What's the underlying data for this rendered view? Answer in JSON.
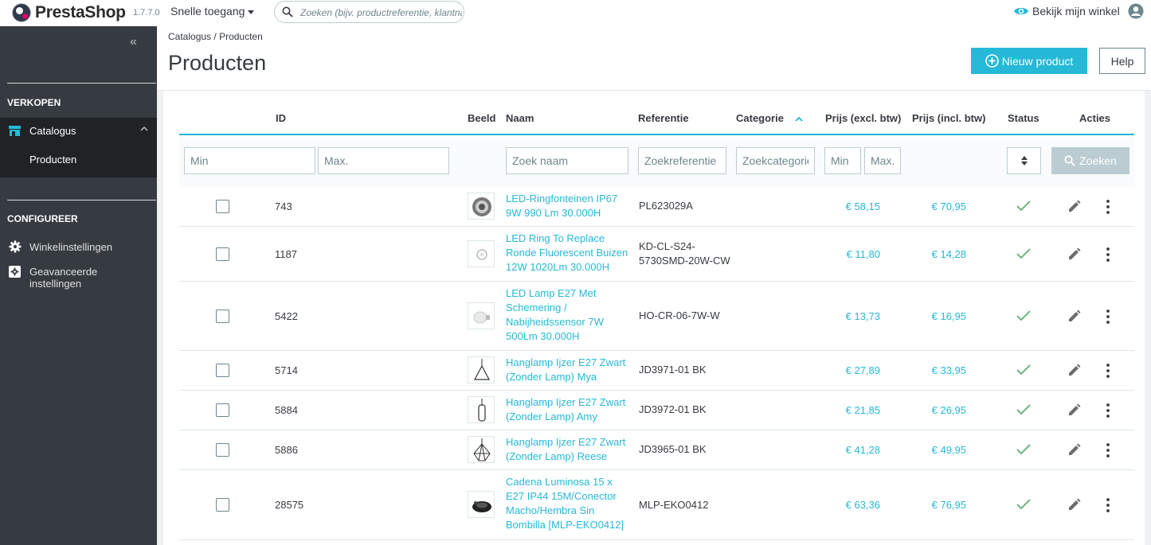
{
  "app": {
    "logo_text": "PrestaShop",
    "version": "1.7.7.0",
    "quick_access": "Snelle toegang",
    "search_placeholder": "Zoeken (bijv. productreferentie, klantnaam...)",
    "view_shop": "Bekijk mijn winkel"
  },
  "sidebar": {
    "section_sell": "VERKOPEN",
    "catalog": "Catalogus",
    "products": "Producten",
    "section_configure": "CONFIGUREER",
    "shop_settings": "Winkelinstellingen",
    "advanced_settings": "Geavanceerde instellingen"
  },
  "header": {
    "breadcrumb_parent": "Catalogus",
    "breadcrumb_sep": "/",
    "breadcrumb_current": "Producten",
    "title": "Producten",
    "new_product": "Nieuw product",
    "help": "Help"
  },
  "table": {
    "columns": {
      "id": "ID",
      "image": "Beeld",
      "name": "Naam",
      "reference": "Referentie",
      "category": "Categorie",
      "price_excl": "Prijs (excl. btw)",
      "price_incl": "Prijs (incl. btw)",
      "status": "Status",
      "actions": "Acties"
    },
    "filters": {
      "id_min": "Min",
      "id_max": "Max.",
      "name": "Zoek naam",
      "reference": "Zoekreferentie",
      "category": "Zoekcategorie",
      "price_min": "Min",
      "price_max": "Max.",
      "search_button": "Zoeken"
    },
    "rows": [
      {
        "id": "743",
        "name": "LED-Ringfonteinen IP67 9W 990 Lm 30.000H",
        "reference": "PL623029A",
        "price_excl": "€ 58,15",
        "price_incl": "€ 70,95",
        "thumb": "ring-fountain"
      },
      {
        "id": "1187",
        "name": "LED Ring To Replace Ronde Fluorescent Buizen 12W 1020Lm 30.000H",
        "reference": "KD-CL-S24-5730SMD-20W-CW",
        "price_excl": "€ 11,80",
        "price_incl": "€ 14,28",
        "thumb": "led-ring"
      },
      {
        "id": "5422",
        "name": "LED Lamp E27 Met Schemering / Nabijheidssensor 7W 500Lm 30.000H",
        "reference": "HO-CR-06-7W-W",
        "price_excl": "€ 13,73",
        "price_incl": "€ 16,95",
        "thumb": "bulb"
      },
      {
        "id": "5714",
        "name": "Hanglamp Ijzer E27 Zwart (Zonder Lamp) Mya",
        "reference": "JD3971-01 BK",
        "price_excl": "€ 27,89",
        "price_incl": "€ 33,95",
        "thumb": "pendant-triangle"
      },
      {
        "id": "5884",
        "name": "Hanglamp Ijzer E27 Zwart (Zonder Lamp) Amy",
        "reference": "JD3972-01 BK",
        "price_excl": "€ 21,85",
        "price_incl": "€ 26,95",
        "thumb": "pendant-cylinder"
      },
      {
        "id": "5886",
        "name": "Hanglamp Ijzer E27 Zwart (Zonder Lamp) Reese",
        "reference": "JD3965-01 BK",
        "price_excl": "€ 41,28",
        "price_incl": "€ 49,95",
        "thumb": "pendant-cage"
      },
      {
        "id": "28575",
        "name": "Cadena Luminosa 15 x E27 IP44 15M/Conector Macho/Hembra Sin Bombilla [MLP-EKO0412]",
        "reference": "MLP-EKO0412",
        "price_excl": "€ 63,36",
        "price_incl": "€ 76,95",
        "thumb": "cable-reel"
      }
    ]
  },
  "colors": {
    "accent": "#25b9d7",
    "success": "#70b580",
    "sidebar_bg": "#363a41"
  }
}
